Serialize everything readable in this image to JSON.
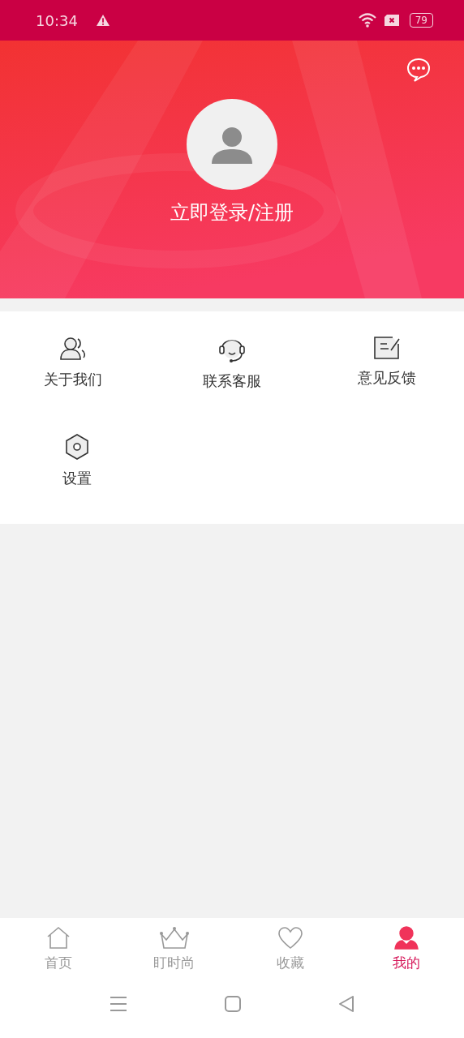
{
  "status_bar": {
    "time": "10:34",
    "battery": "79"
  },
  "header": {
    "login": "立即登录/注册"
  },
  "menu": [
    {
      "kind": "about",
      "label": "关于我们"
    },
    {
      "kind": "service",
      "label": "联系客服"
    },
    {
      "kind": "feedback",
      "label": "意见反馈"
    },
    {
      "kind": "settings",
      "label": "设置"
    }
  ],
  "tabs": [
    {
      "kind": "home",
      "label": "首页",
      "selected": false
    },
    {
      "kind": "crown",
      "label": "盯时尚",
      "selected": false
    },
    {
      "kind": "heart",
      "label": "收藏",
      "selected": false
    },
    {
      "kind": "person",
      "label": "我的",
      "selected": true
    }
  ]
}
